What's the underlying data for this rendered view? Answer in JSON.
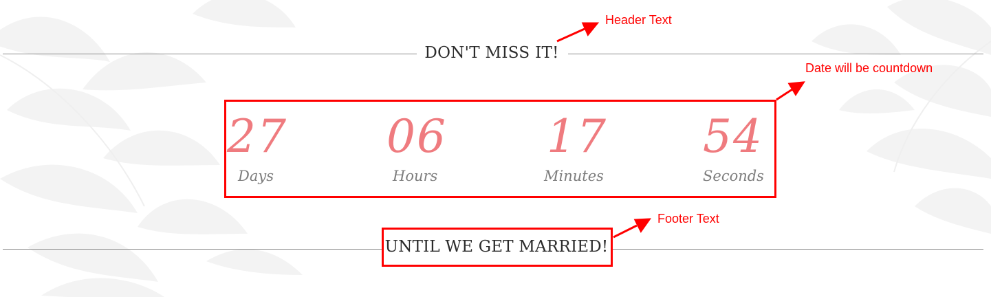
{
  "header": {
    "title": "DON'T MISS IT!"
  },
  "countdown": {
    "units": [
      {
        "value": "27",
        "label": "Days"
      },
      {
        "value": "06",
        "label": "Hours"
      },
      {
        "value": "17",
        "label": "Minutes"
      },
      {
        "value": "54",
        "label": "Seconds"
      }
    ]
  },
  "footer": {
    "title": "UNTIL WE GET MARRIED!"
  },
  "annotations": {
    "header_note": "Header Text",
    "countdown_note": "Date will be countdown",
    "footer_note": "Footer Text"
  },
  "colors": {
    "accent_pink": "#ef7b7f",
    "annotation_red": "#ff0000",
    "heading_text": "#2b2b2b",
    "label_gray": "#7d7d7d",
    "rule_gray": "#8a8a8a"
  }
}
